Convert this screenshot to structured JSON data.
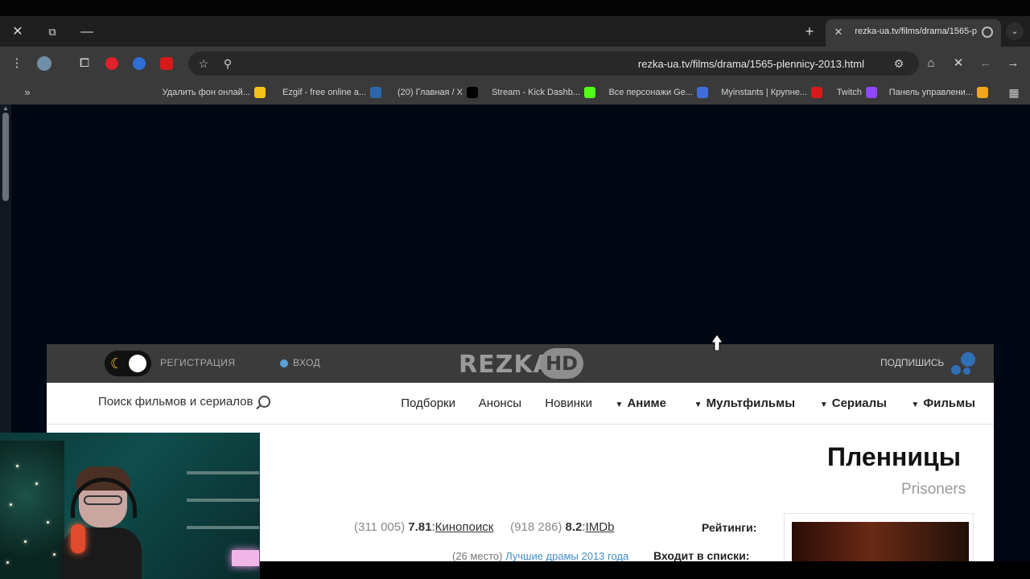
{
  "browser": {
    "tab": {
      "title": "rezka-ua.tv/films/drama/1565-р",
      "close_label": "✕"
    },
    "new_tab_label": "+",
    "window_controls": {
      "close": "✕",
      "restore": "⧉",
      "minimize": "—"
    },
    "address": {
      "url": "rezka-ua.tv/films/drama/1565-plenniсy-2013.html"
    },
    "bookmarks": [
      {
        "label": "Панель управлени...",
        "color": "#f2a51c"
      },
      {
        "label": "Twitch",
        "color": "#9146ff"
      },
      {
        "label": "Myinstants | Крупне...",
        "color": "#d61a1a"
      },
      {
        "label": "Все персонажи Ge...",
        "color": "#3f6ed8"
      },
      {
        "label": "Stream - Kick Dashb...",
        "color": "#53fc18"
      },
      {
        "label": "(20) Главная / X",
        "color": "#000000"
      },
      {
        "label": "Ezgif - free online a...",
        "color": "#2b66a8"
      },
      {
        "label": "Удалить фон онлай...",
        "color": "#f4c21a"
      }
    ],
    "bookmarks_more": "»"
  },
  "site": {
    "header": {
      "subscribe": "ПОДПИШИСЬ",
      "logo_text": "REZKA",
      "logo_hd": "HD",
      "login": "ВХОД",
      "register": "РЕГИСТРАЦИЯ"
    },
    "nav": {
      "items": [
        {
          "label": "Фильмы",
          "bold": true,
          "dropdown": true
        },
        {
          "label": "Сериалы",
          "bold": true,
          "dropdown": true
        },
        {
          "label": "Мультфильмы",
          "bold": true,
          "dropdown": true
        },
        {
          "label": "Аниме",
          "bold": true,
          "dropdown": true
        },
        {
          "label": "Новинки",
          "bold": false,
          "dropdown": false
        },
        {
          "label": "Анонсы",
          "bold": false,
          "dropdown": false
        },
        {
          "label": "Подборки",
          "bold": false,
          "dropdown": false
        }
      ],
      "search_placeholder": "Поиск фильмов и сериалов"
    },
    "movie": {
      "title": "Пленницы",
      "original_title": "Prisoners",
      "ratings_label": "Рейтинги:",
      "imdb_label": "IMDb",
      "imdb_value": "8.2",
      "imdb_votes": "(918 286)",
      "kp_label": "Кинопоиск",
      "kp_value": "7.81",
      "kp_votes": "(311 005)",
      "lists_label": "Входит в списки:",
      "lists_value": "Лучшие драмы 2013 года",
      "lists_place": "(26 место)"
    }
  },
  "colors": {
    "page_bg": "#010813",
    "header_bg": "#3b3b3b",
    "accent_blue": "#2f6fb6",
    "link": "#3f8fc7"
  }
}
